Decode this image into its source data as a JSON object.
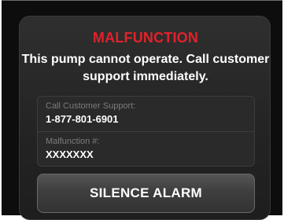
{
  "alert": {
    "title": "MALFUNCTION",
    "message": "This pump cannot operate. Call customer support immediately."
  },
  "support": {
    "label": "Call Customer Support:",
    "phone": "1-877-801-6901"
  },
  "malfunction": {
    "label": "Malfunction #:",
    "code": "XXXXXXX"
  },
  "actions": {
    "silence_label": "SILENCE ALARM"
  },
  "colors": {
    "title_red": "#e1222a",
    "background": "#0d0d0d",
    "panel": "#2a2a2a"
  }
}
